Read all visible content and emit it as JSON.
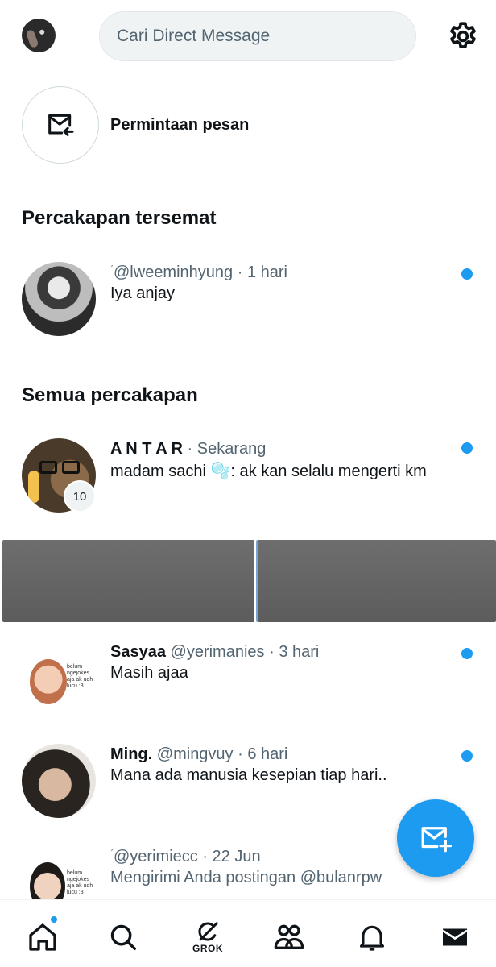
{
  "header": {
    "search_placeholder": "Cari Direct Message"
  },
  "requests": {
    "label": "Permintaan pesan"
  },
  "sections": {
    "pinned_title": "Percakapan tersemat",
    "all_title": "Semua percakapan"
  },
  "pinned": [
    {
      "name": "",
      "handle": "@lweeminhyung",
      "time": "1 hari",
      "preview": "Iya anjay",
      "unread": true
    }
  ],
  "conversations": [
    {
      "name": "A N T A R",
      "handle": "",
      "time": "Sekarang",
      "preview": "madam sachi 🫧: ak kan selalu mengerti km",
      "badge": "10",
      "unread": true
    },
    {
      "name": "Sasyaa",
      "handle": "@yerimanies",
      "time": "3 hari",
      "preview": "Masih ajaa",
      "unread": true
    },
    {
      "name": "Ming.",
      "handle": "@mingvuy",
      "time": "6 hari",
      "preview": "Mana ada manusia kesepian tiap hari..",
      "unread": true
    },
    {
      "name": "",
      "handle": "@yerimiecc",
      "time": "22 Jun",
      "preview": "Mengirimi Anda postingan @bulanrpw",
      "unread": false
    }
  ],
  "nav": {
    "grok_label": "GROK"
  },
  "colors": {
    "accent": "#1d9bf0",
    "text": "#0f1419",
    "muted": "#536471"
  }
}
